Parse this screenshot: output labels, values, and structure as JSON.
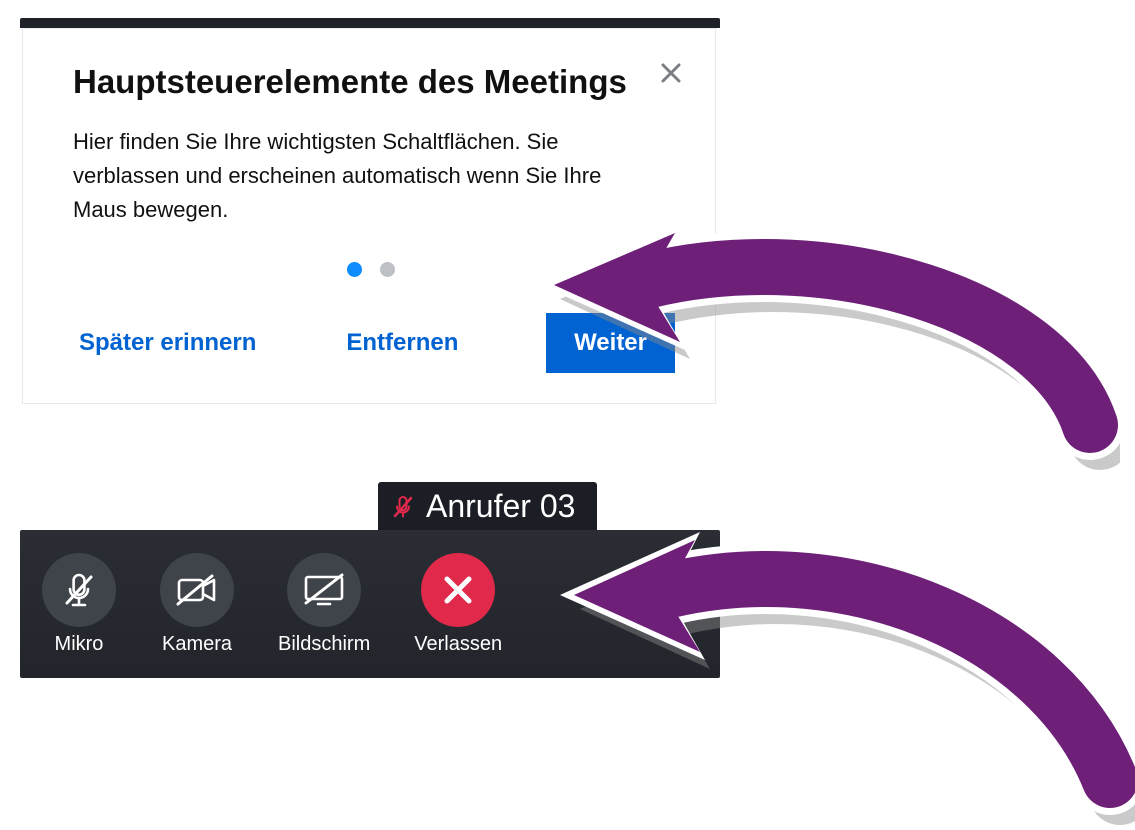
{
  "popup": {
    "title": "Hauptsteuerelemente des Meetings",
    "body": "Hier finden Sie Ihre wichtigsten Schaltflächen. Sie verblassen und erscheinen automatisch wenn Sie Ihre Maus bewegen.",
    "step_active": 1,
    "step_total": 2,
    "later_label": "Später erinnern",
    "remove_label": "Entfernen",
    "next_label": "Weiter"
  },
  "caller": {
    "name": "Anrufer 03",
    "muted": true
  },
  "controls": {
    "mic": "Mikro",
    "camera": "Kamera",
    "screen": "Bildschirm",
    "leave": "Verlassen"
  },
  "colors": {
    "accent_blue": "#0163d1",
    "leave_red": "#e0294b",
    "arrow_purple": "#6e2079"
  }
}
